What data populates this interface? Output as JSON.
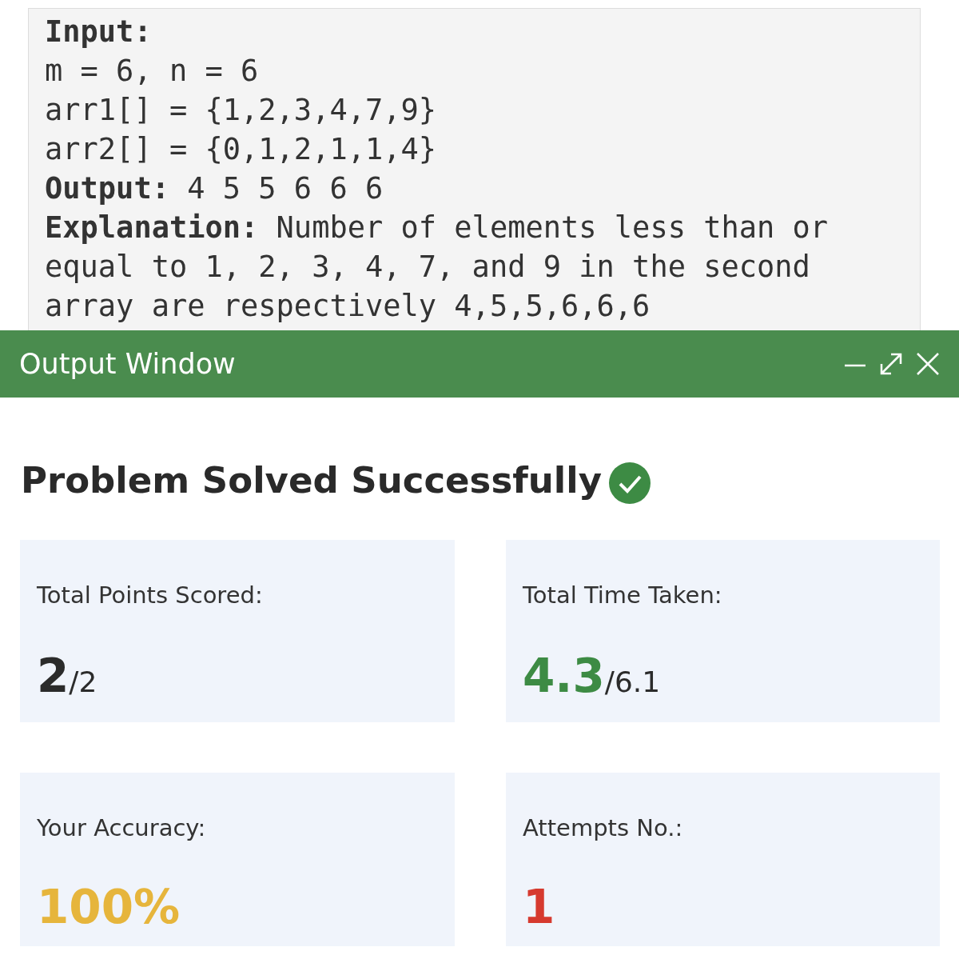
{
  "code_panel": {
    "lines": [
      {
        "kind": "heading",
        "text": "Input:"
      },
      {
        "kind": "plain",
        "text": "m = 6, n = 6"
      },
      {
        "kind": "plain",
        "text": "arr1[] = {1,2,3,4,7,9}"
      },
      {
        "kind": "plain",
        "text": "arr2[] = {0,1,2,1,1,4}"
      },
      {
        "kind": "plain",
        "text": "**Output:** 4 5 5 6 6 6"
      },
      {
        "kind": "plain",
        "text": "**Explanation:** Number of elements less than or equal to 1, 2, 3, 4, 7, and 9 in the second array are respectively 4,5,5,6,6,6"
      }
    ]
  },
  "output_window": {
    "title": "Output Window"
  },
  "result": {
    "title": "Problem Solved Successfully",
    "solved": true
  },
  "stats": [
    {
      "label": "Total Points Scored:",
      "value": "2",
      "total": "/2",
      "color": "#2b2b2b"
    },
    {
      "label": "Total Time Taken:",
      "value": "4.3",
      "total": "/6.1",
      "color": "#3d8b44"
    },
    {
      "label": "Your Accuracy:",
      "value": "100%",
      "color": "#e6b53c"
    },
    {
      "label": "Attempts No.:",
      "value": "1",
      "color": "#d63a2f"
    }
  ]
}
